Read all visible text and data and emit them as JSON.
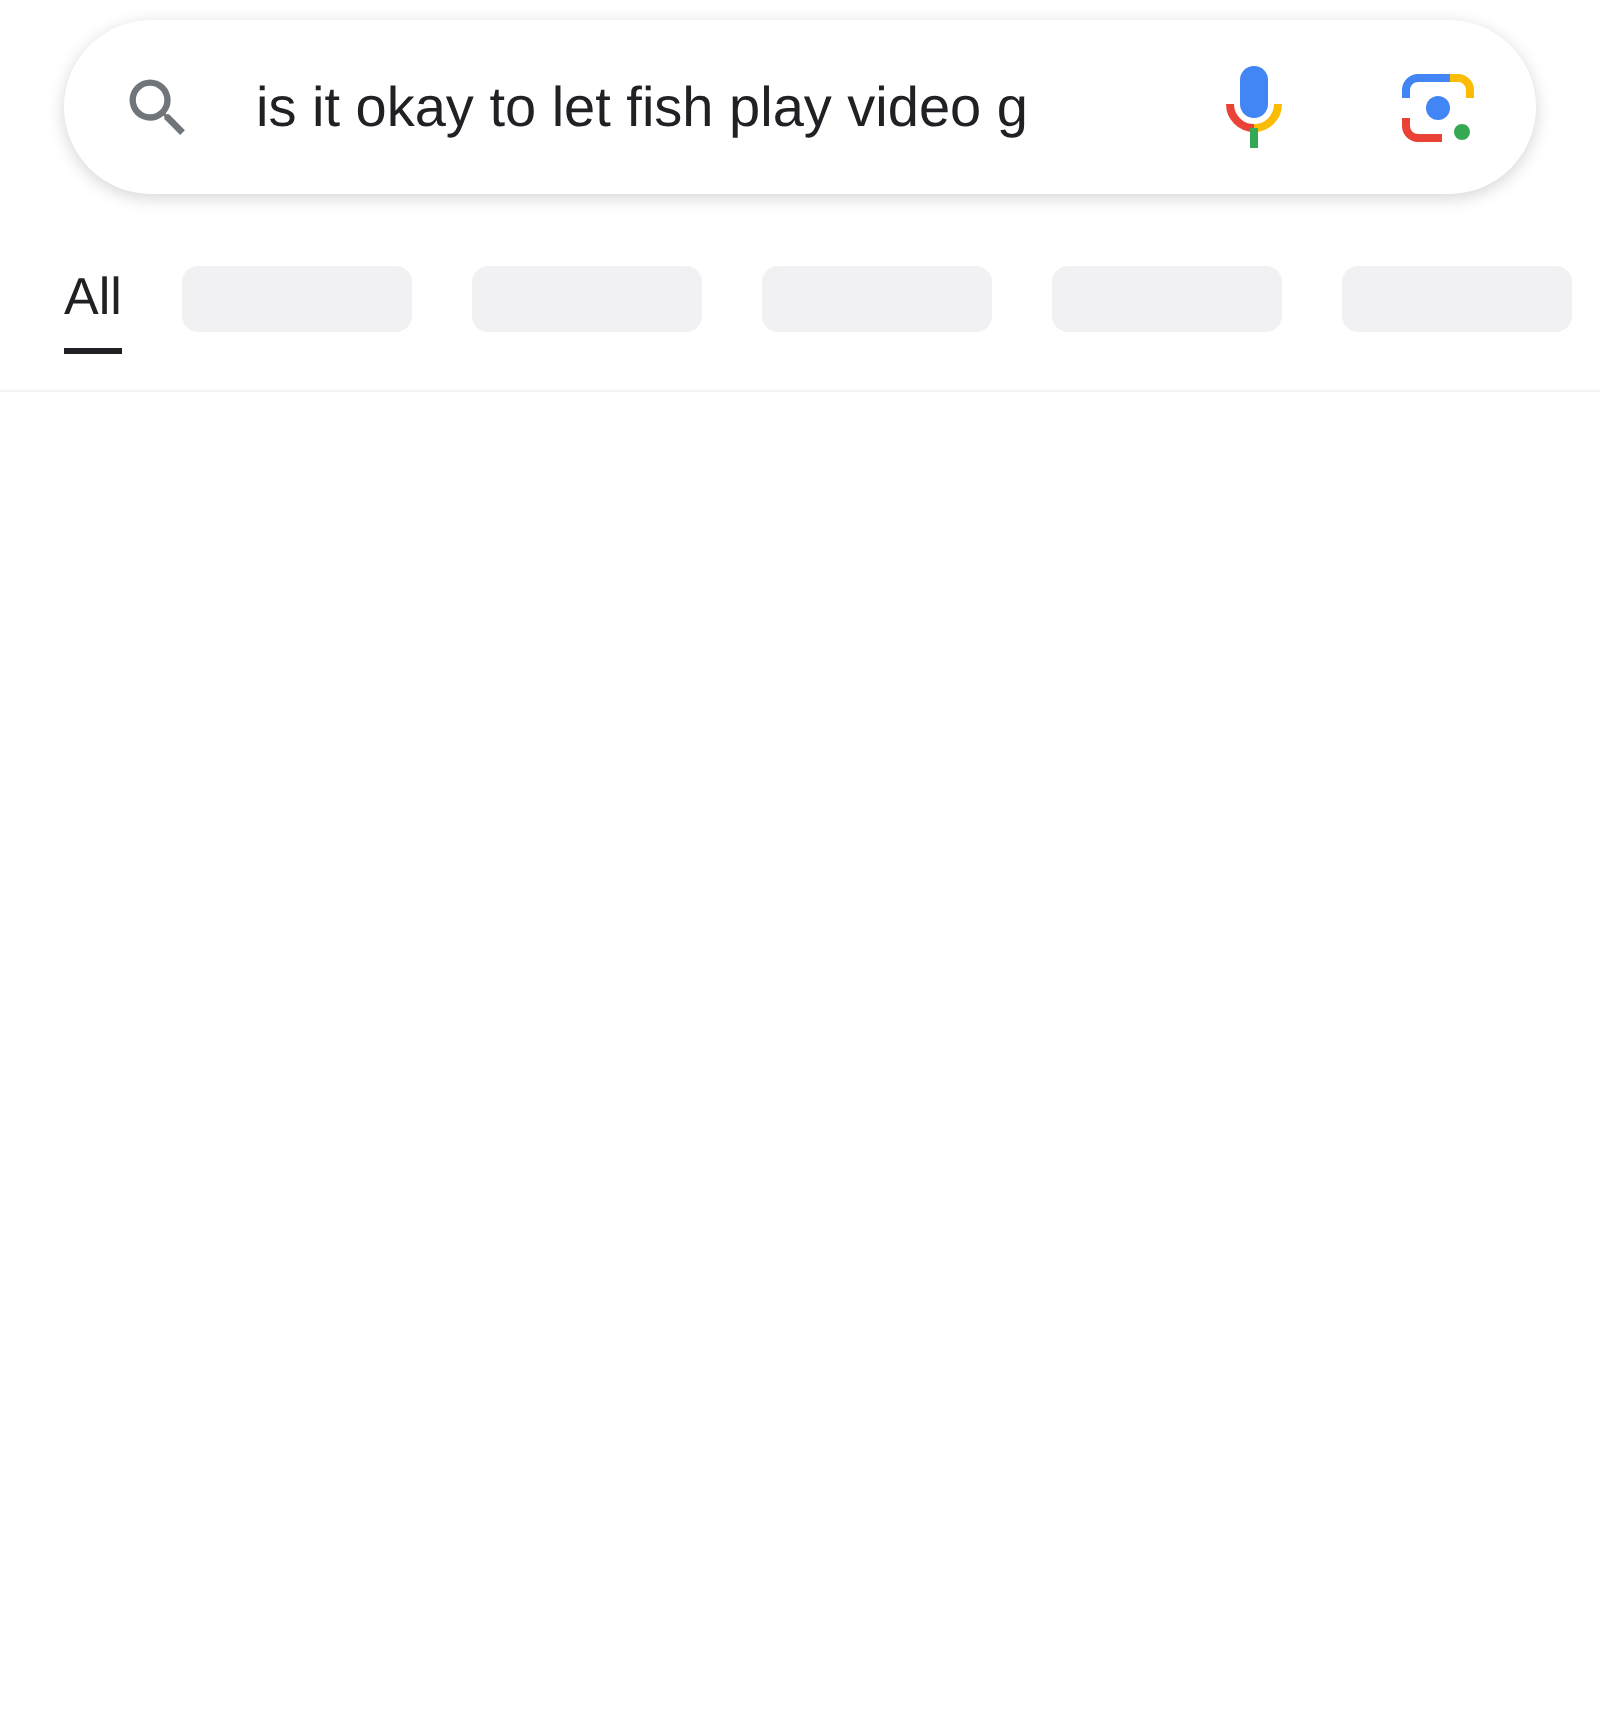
{
  "search": {
    "value": "is it okay to let fish play video g"
  },
  "tabs": [
    {
      "kind": "tab",
      "label": "All",
      "selected": true
    },
    {
      "kind": "skeleton"
    },
    {
      "kind": "skeleton"
    },
    {
      "kind": "skeleton"
    },
    {
      "kind": "skeleton"
    },
    {
      "kind": "skeleton"
    }
  ]
}
